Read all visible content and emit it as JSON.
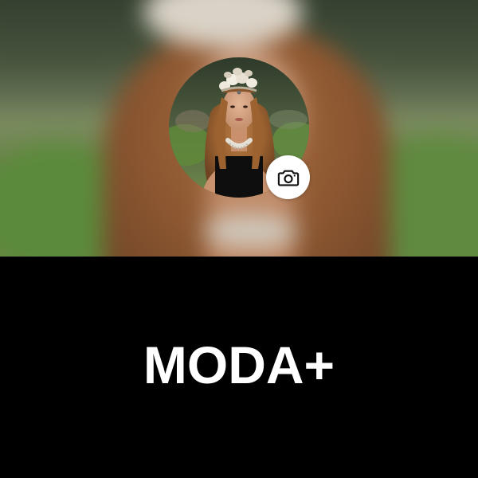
{
  "profile": {
    "name": "MODA+",
    "avatar_icon": "profile-photo",
    "edit_photo_icon": "camera-icon"
  },
  "colors": {
    "background": "#000000",
    "title_text": "#ffffff",
    "camera_button_bg": "#ffffff",
    "camera_icon": "#111111"
  }
}
